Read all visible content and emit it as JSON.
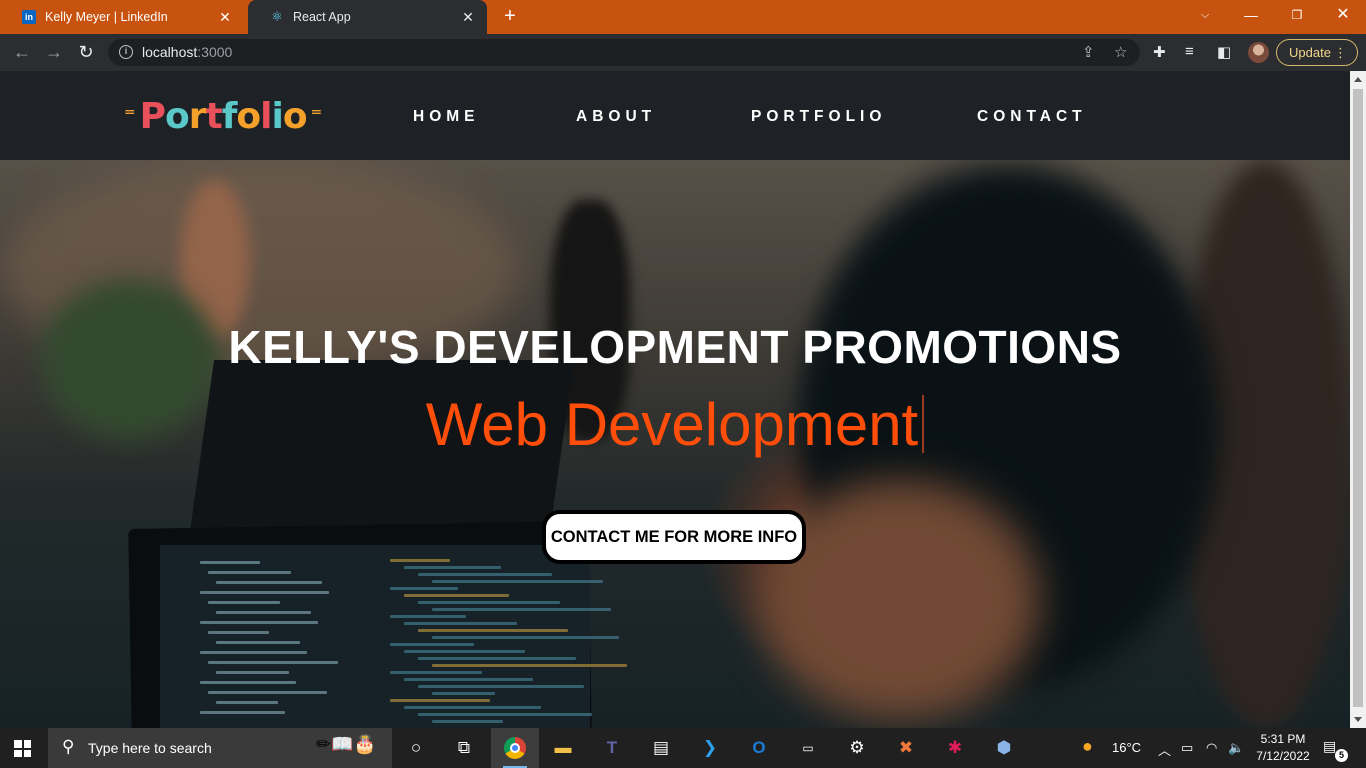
{
  "browser": {
    "tabs": [
      {
        "title": "Kelly Meyer | LinkedIn",
        "favicon": "linkedin-icon"
      },
      {
        "title": "React App",
        "favicon": "react-icon",
        "active": true
      }
    ],
    "url_host": "localhost",
    "url_port": ":3000",
    "update_label": "Update",
    "tab_bar_color": "#c8520f"
  },
  "site": {
    "logo_text": "Portfolio",
    "nav": [
      "HOME",
      "ABOUT",
      "PORTFOLIO",
      "CONTACT"
    ],
    "hero_title": "KELLY'S DEVELOPMENT PROMOTIONS",
    "hero_typed": "Web Development",
    "cta_label": "CONTACT ME FOR MORE INFO",
    "accent_color": "#ff4d0a"
  },
  "taskbar": {
    "search_placeholder": "Type here to search",
    "weather": "16°C",
    "time": "5:31 PM",
    "date": "7/12/2022",
    "notification_count": "5"
  }
}
